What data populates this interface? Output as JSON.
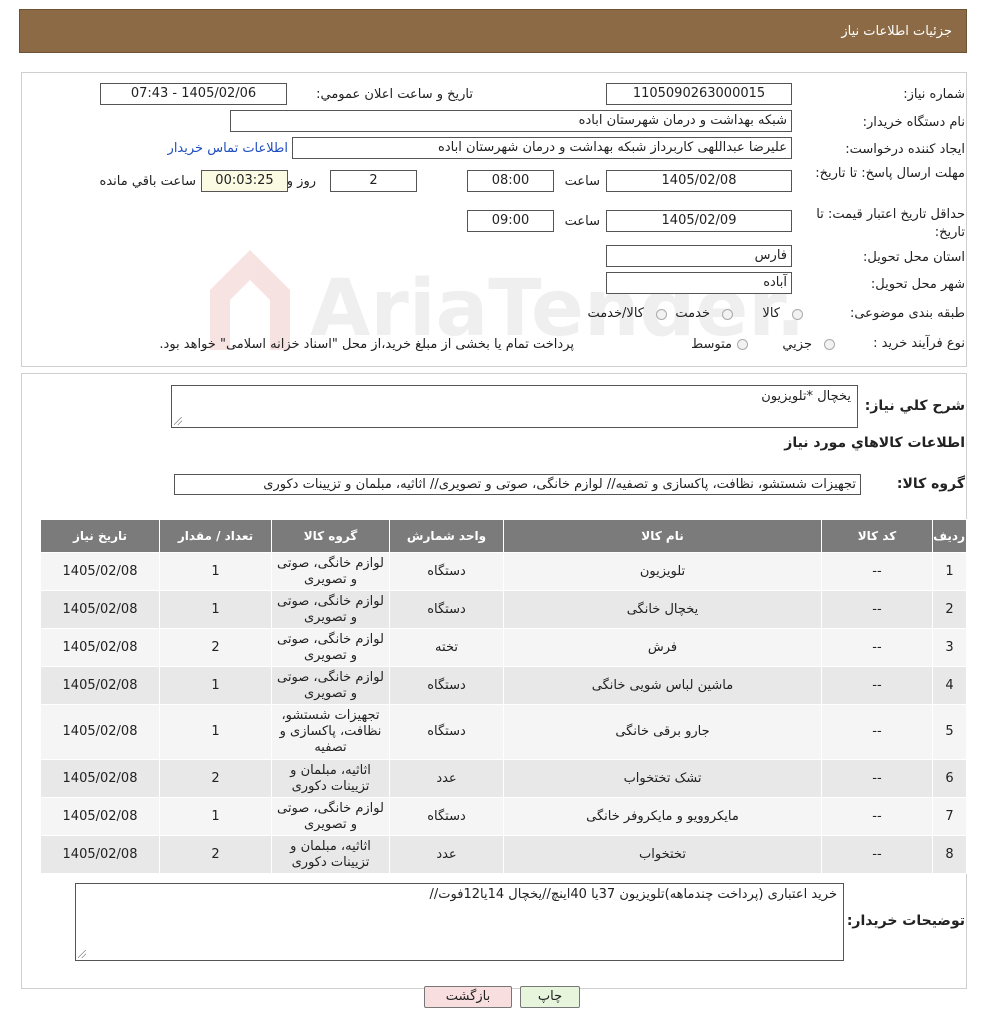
{
  "header": {
    "title": "جزئیات اطلاعات نیاز"
  },
  "watermark": {
    "text": "AriaTender.neT"
  },
  "form": {
    "need_number_label": "شماره نیاز:",
    "need_number": "1105090263000015",
    "announce_label": "تاریخ و ساعت اعلان عمومي:",
    "announce_value": "1405/02/06 - 07:43",
    "buyer_org_label": "نام دستگاه خريدار:",
    "buyer_org": "شبکه بهداشت و درمان شهرستان اباده",
    "creator_label": "ایجاد کننده درخواست:",
    "creator": "علیرضا عبداللهی کاربرداز شبکه بهداشت و درمان شهرستان اباده",
    "contact_link": "اطلاعات تماس خریدار",
    "deadline_label": "مهلت ارسال پاسخ: تا تاریخ:",
    "deadline_date": "1405/02/08",
    "time_label": "ساعت",
    "deadline_time": "08:00",
    "days": "2",
    "days_label": "روز و",
    "remaining": "00:03:25",
    "remaining_label": "ساعت باقي مانده",
    "validity_label": "حداقل تاریخ اعتبار قیمت: تا تاریخ:",
    "validity_date": "1405/02/09",
    "validity_time": "09:00",
    "province_label": "استان محل تحویل:",
    "province": "فارس",
    "city_label": "شهر محل تحویل:",
    "city": "آباده",
    "category_label": "طبقه بندی موضوعی:",
    "category_options": [
      "کالا",
      "خدمت",
      "کالا/خدمت"
    ],
    "process_label": "نوع فرآیند خرید :",
    "process_options": [
      "جزیي",
      "متوسط"
    ],
    "process_note": "پرداخت تمام یا بخشی از مبلغ خرید،از محل \"اسناد خزانه اسلامی\" خواهد بود."
  },
  "summary": {
    "general_label": "شرح كلي نياز:",
    "general_value": "یخچال *تلویزیون",
    "items_title": "اطلاعات كالاهاي مورد نياز",
    "group_label": "گروه کالا:",
    "group_value": "تجهیزات شستشو، نظافت، پاکسازی و تصفیه// لوازم خانگی، صوتی و تصویری// اثاثیه، مبلمان و تزیینات دکوری"
  },
  "table": {
    "headers": [
      "رديف",
      "کد کالا",
      "نام کالا",
      "واحد شمارش",
      "گروه کالا",
      "تعداد / مقدار",
      "تاريخ نياز"
    ],
    "rows": [
      [
        "1",
        "--",
        "تلویزیون",
        "دستگاه",
        "لوازم خانگی، صوتی و تصویری",
        "1",
        "1405/02/08"
      ],
      [
        "2",
        "--",
        "یخچال خانگی",
        "دستگاه",
        "لوازم خانگی، صوتی و تصویری",
        "1",
        "1405/02/08"
      ],
      [
        "3",
        "--",
        "فرش",
        "تخته",
        "لوازم خانگی، صوتی و تصویری",
        "2",
        "1405/02/08"
      ],
      [
        "4",
        "--",
        "ماشین لباس شویی خانگی",
        "دستگاه",
        "لوازم خانگی، صوتی و تصویری",
        "1",
        "1405/02/08"
      ],
      [
        "5",
        "--",
        "جارو برقی خانگی",
        "دستگاه",
        "تجهیزات شستشو، نظافت، پاکسازی و تصفیه",
        "1",
        "1405/02/08"
      ],
      [
        "6",
        "--",
        "تشک تختخواب",
        "عدد",
        "اثاثیه، مبلمان و تزیینات دکوری",
        "2",
        "1405/02/08"
      ],
      [
        "7",
        "--",
        "مایکروویو و مایکروفر خانگی",
        "دستگاه",
        "لوازم خانگی، صوتی و تصویری",
        "1",
        "1405/02/08"
      ],
      [
        "8",
        "--",
        "تختخواب",
        "عدد",
        "اثاثیه، مبلمان و تزیینات دکوری",
        "2",
        "1405/02/08"
      ]
    ]
  },
  "notes": {
    "label": "توضیحات خریدار:",
    "value": "خرید اعتباری (پرداخت چندماهه)تلویزیون 37یا 40اینچ//یخچال 14یا12فوت//"
  },
  "buttons": {
    "print": "چاپ",
    "back": "بازگشت"
  }
}
